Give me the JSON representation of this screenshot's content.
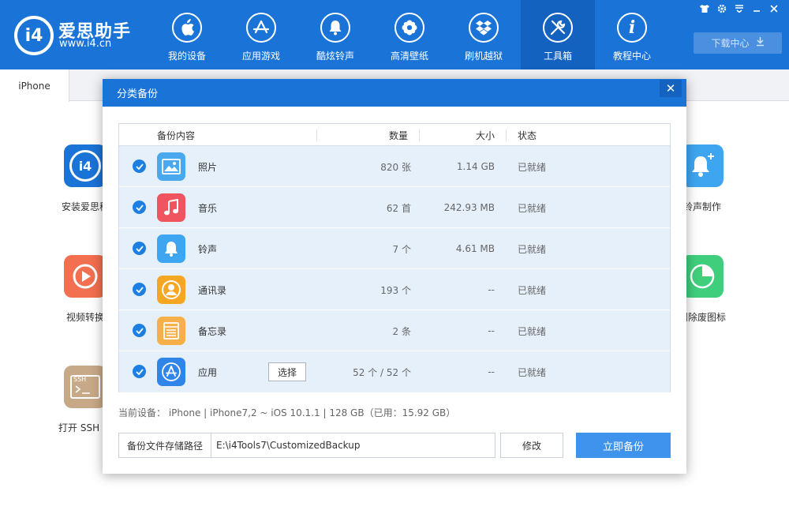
{
  "app": {
    "logo_text": "爱思助手",
    "logo_url": "www.i4.cn",
    "logo_badge": "i4"
  },
  "nav": [
    {
      "label": "我的设备",
      "icon": "apple-icon"
    },
    {
      "label": "应用游戏",
      "icon": "app-store-icon"
    },
    {
      "label": "酷炫铃声",
      "icon": "bell-icon"
    },
    {
      "label": "高清壁纸",
      "icon": "flower-icon"
    },
    {
      "label": "刷机越狱",
      "icon": "box-icon"
    },
    {
      "label": "工具箱",
      "icon": "tools-icon",
      "active": true
    },
    {
      "label": "教程中心",
      "icon": "info-icon"
    }
  ],
  "download_label": "下载中心",
  "tab": {
    "label": "iPhone"
  },
  "tools": {
    "install_label": "安装爱思移",
    "video_label": "视频转换",
    "ssh_label": "打开 SSH 通",
    "ringtone_label": "铃声制作",
    "remove_icon_label": "删除废图标",
    "ssh_badge": "SSH"
  },
  "dialog": {
    "title": "分类备份",
    "close": "✕",
    "columns": {
      "content": "备份内容",
      "quantity": "数量",
      "size": "大小",
      "status": "状态"
    },
    "rows": [
      {
        "name": "照片",
        "quantity": "820 张",
        "size": "1.14 GB",
        "status": "已就绪",
        "icon": "photos-icon",
        "color": "#4aa8ef"
      },
      {
        "name": "音乐",
        "quantity": "62 首",
        "size": "242.93 MB",
        "status": "已就绪",
        "icon": "music-icon",
        "color": "#f0555f"
      },
      {
        "name": "铃声",
        "quantity": "7 个",
        "size": "4.61 MB",
        "status": "已就绪",
        "icon": "ringtone-bell-icon",
        "color": "#3ea6f0"
      },
      {
        "name": "通讯录",
        "quantity": "193 个",
        "size": "--",
        "status": "已就绪",
        "icon": "contacts-icon",
        "color": "#f5a623"
      },
      {
        "name": "备忘录",
        "quantity": "2 条",
        "size": "--",
        "status": "已就绪",
        "icon": "notes-icon",
        "color": "#f6b04a"
      },
      {
        "name": "应用",
        "quantity": "52 个 / 52 个",
        "size": "--",
        "status": "已就绪",
        "icon": "apps-icon",
        "color": "#2f86e8",
        "select_label": "选择"
      }
    ],
    "device_info": "当前设备： iPhone   |   iPhone7,2 ~ iOS 10.1.1   |   128 GB（已用：15.92 GB）",
    "path_label": "备份文件存储路径",
    "path_value": "E:\\i4Tools7\\CustomizedBackup",
    "modify_label": "修改",
    "backup_label": "立即备份"
  },
  "colors": {
    "primary": "#1a73d6",
    "primary_dark": "#1462bf",
    "row_bg": "#e6f0fb",
    "check": "#1e7fe2",
    "backup_btn": "#3f93ec"
  }
}
